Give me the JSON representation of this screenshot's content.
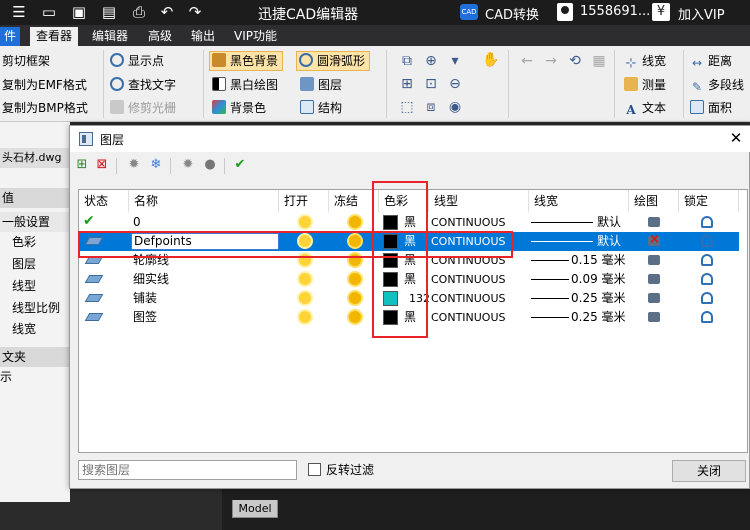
{
  "app": {
    "title": "迅捷CAD编辑器",
    "cad_convert_label": "CAD转换",
    "cad_badge": "CAD",
    "phone": "1558691...",
    "vip_label": "加入VIP",
    "vip_icon": "¥"
  },
  "menu": {
    "tabs": [
      {
        "label": "件"
      },
      {
        "label": "查看器"
      },
      {
        "label": "编辑器"
      },
      {
        "label": "高级"
      },
      {
        "label": "输出"
      },
      {
        "label": "VIP功能"
      }
    ],
    "active": "查看器"
  },
  "ribbon": {
    "clipboard": [
      "剪切框架",
      "复制为EMF格式",
      "复制为BMP格式"
    ],
    "view": [
      "显示点",
      "查找文字",
      "修剪光栅"
    ],
    "background": [
      "黑色背景",
      "黑白绘图",
      "背景色"
    ],
    "objects": [
      "圆滑弧形",
      "图层",
      "结构"
    ],
    "measure": [
      "线宽",
      "测量",
      "文本"
    ],
    "right": [
      "距离",
      "多段线",
      "面积"
    ]
  },
  "left_panel": {
    "file_tab": "头石材.dwg",
    "header_value": "值",
    "general_header": "一般设置",
    "properties": [
      "色彩",
      "图层",
      "线型",
      "线型比例",
      "线宽"
    ],
    "folder_header": "文夹",
    "folder_item": "示"
  },
  "dialog": {
    "title": "图层",
    "close_icon": "✕",
    "columns": [
      "状态",
      "名称",
      "打开",
      "冻结",
      "色彩",
      "线型",
      "线宽",
      "绘图",
      "锁定"
    ],
    "layers": [
      {
        "status": "current",
        "name": "0",
        "color_name": "黑",
        "color_hex": "#000000",
        "linetype": "CONTINUOUS",
        "lineweight": "默认",
        "plot": true,
        "selected": false
      },
      {
        "status": "layer",
        "name": "Defpoints",
        "color_name": "黑",
        "color_hex": "#000000",
        "linetype": "CONTINUOUS",
        "lineweight": "默认",
        "plot": false,
        "selected": true
      },
      {
        "status": "layer",
        "name": "轮廓线",
        "color_name": "黑",
        "color_hex": "#000000",
        "linetype": "CONTINUOUS",
        "lineweight": "0.15 毫米",
        "plot": true,
        "selected": false
      },
      {
        "status": "layer",
        "name": "细实线",
        "color_name": "黑",
        "color_hex": "#000000",
        "linetype": "CONTINUOUS",
        "lineweight": "0.09 毫米",
        "plot": true,
        "selected": false
      },
      {
        "status": "layer",
        "name": "铺装",
        "color_name": "132",
        "color_hex": "#12c0c0",
        "linetype": "CONTINUOUS",
        "lineweight": "0.25 毫米",
        "plot": true,
        "selected": false
      },
      {
        "status": "layer",
        "name": "图签",
        "color_name": "黑",
        "color_hex": "#000000",
        "linetype": "CONTINUOUS",
        "lineweight": "0.25 毫米",
        "plot": true,
        "selected": false
      }
    ],
    "search_placeholder": "搜索图层",
    "reverse_filter_label": "反转过滤",
    "close_button": "关闭"
  },
  "bottom": {
    "model_tab": "Model"
  },
  "colors": {
    "selection": "#0078d7",
    "highlight_box": "#e8232a",
    "title_bar": "#1c1c1c",
    "file_tab": "#1e6fd9"
  }
}
